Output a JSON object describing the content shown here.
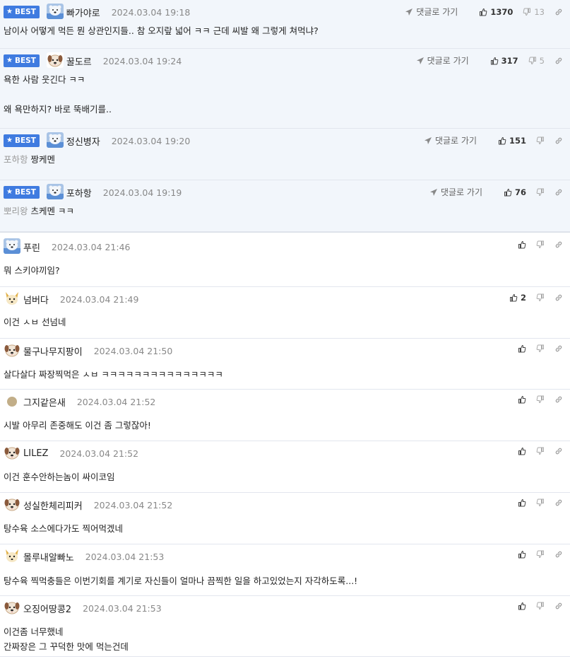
{
  "labels": {
    "best": "BEST",
    "goto_reply": "댓글로 가기"
  },
  "colors": {
    "accent": "#3f7be0",
    "best_bg": "#f2f6fb",
    "muted": "#999999"
  },
  "comments": [
    {
      "best": true,
      "avatar": "polar-bear-avatar",
      "nick": "빠가야로",
      "date": "2024.03.04 19:18",
      "up": "1370",
      "down": "13",
      "goto": true,
      "reply_to": "",
      "lines": [
        "남이사 어떻게 먹든 뭔 상관인지들.. 참 오지랖 넓어 ㅋㅋ 근데 씨발 왜 그렇게 쳐먹냐?"
      ]
    },
    {
      "best": true,
      "avatar": "dog-avatar",
      "nick": "꿀도르",
      "date": "2024.03.04 19:24",
      "up": "317",
      "down": "5",
      "goto": true,
      "reply_to": "",
      "lines": [
        "욕한 사람 웃긴다 ㅋㅋ",
        "",
        "왜 욕만하지? 바로 뚝배기를.."
      ]
    },
    {
      "best": true,
      "avatar": "polar-bear-avatar",
      "nick": "정신병자",
      "date": "2024.03.04 19:20",
      "up": "151",
      "down": "",
      "goto": true,
      "reply_to": "포하항",
      "lines": [
        "짱케멘"
      ]
    },
    {
      "best": true,
      "avatar": "polar-bear-avatar",
      "nick": "포하항",
      "date": "2024.03.04 19:19",
      "up": "76",
      "down": "",
      "goto": true,
      "reply_to": "뽀리왕",
      "lines": [
        "츠케멘 ㅋㅋ"
      ]
    },
    {
      "best": false,
      "avatar": "polar-bear-avatar",
      "nick": "푸린",
      "date": "2024.03.04 21:46",
      "up": "",
      "down": "",
      "goto": false,
      "reply_to": "",
      "lines": [
        "뭐 스키야끼임?"
      ]
    },
    {
      "best": false,
      "avatar": "fox-avatar",
      "nick": "넘버다",
      "date": "2024.03.04 21:49",
      "up": "2",
      "down": "",
      "goto": false,
      "reply_to": "",
      "lines": [
        "이건 ㅅㅂ 선넘네"
      ]
    },
    {
      "best": false,
      "avatar": "dog-avatar",
      "nick": "물구나무지팡이",
      "date": "2024.03.04 21:50",
      "up": "",
      "down": "",
      "goto": false,
      "reply_to": "",
      "lines": [
        "살다살다 짜장찍먹은 ㅅㅂ ㅋㅋㅋㅋㅋㅋㅋㅋㅋㅋㅋㅋㅋㅋㅋ"
      ]
    },
    {
      "best": false,
      "avatar": "dot-avatar",
      "nick": "그지같은새",
      "date": "2024.03.04 21:52",
      "up": "",
      "down": "",
      "goto": false,
      "reply_to": "",
      "lines": [
        "시발 아무리 존중해도 이건 좀 그렇잖아!"
      ]
    },
    {
      "best": false,
      "avatar": "dog-avatar",
      "nick": "LILEZ",
      "date": "2024.03.04 21:52",
      "up": "",
      "down": "",
      "goto": false,
      "reply_to": "",
      "lines": [
        "이건 훈수안하는놈이 싸이코임"
      ]
    },
    {
      "best": false,
      "avatar": "dog-avatar",
      "nick": "성실한체리피커",
      "date": "2024.03.04 21:52",
      "up": "",
      "down": "",
      "goto": false,
      "reply_to": "",
      "lines": [
        "탕수육 소스에다가도 찍어먹겠네"
      ]
    },
    {
      "best": false,
      "avatar": "fox-avatar",
      "nick": "몰루내알빠노",
      "date": "2024.03.04 21:53",
      "up": "",
      "down": "",
      "goto": false,
      "reply_to": "",
      "lines": [
        "탕수육 찍먹충들은 이번기회를 계기로 자신들이 얼마나 끔찍한 일을 하고있었는지 자각하도록...!"
      ]
    },
    {
      "best": false,
      "avatar": "dog-avatar",
      "nick": "오징어땅콩2",
      "date": "2024.03.04 21:53",
      "up": "",
      "down": "",
      "goto": false,
      "reply_to": "",
      "lines": [
        "이건좀 너무했네",
        "간짜장은 그 꾸덕한 맛에 먹는건데"
      ]
    }
  ]
}
